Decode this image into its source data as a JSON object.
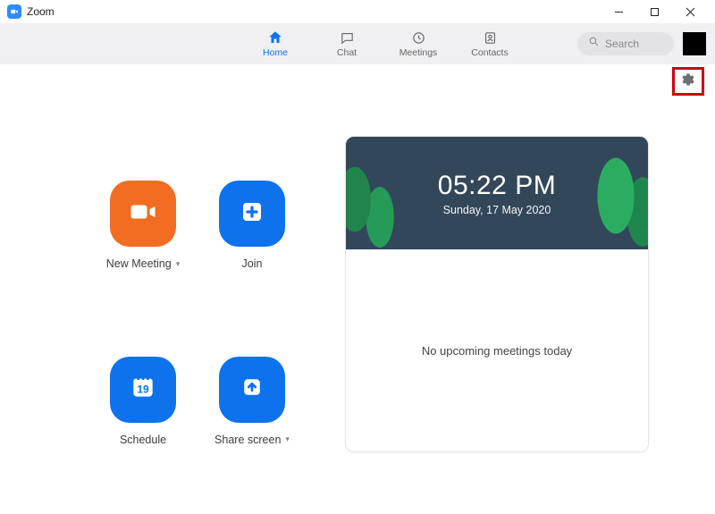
{
  "app": {
    "title": "Zoom"
  },
  "nav": {
    "home": "Home",
    "chat": "Chat",
    "meetings": "Meetings",
    "contacts": "Contacts"
  },
  "search": {
    "placeholder": "Search"
  },
  "actions": {
    "new_meeting": "New Meeting",
    "join": "Join",
    "schedule": "Schedule",
    "schedule_day": "19",
    "share_screen": "Share screen"
  },
  "card": {
    "time": "05:22 PM",
    "date": "Sunday, 17 May 2020",
    "empty": "No upcoming meetings today"
  }
}
